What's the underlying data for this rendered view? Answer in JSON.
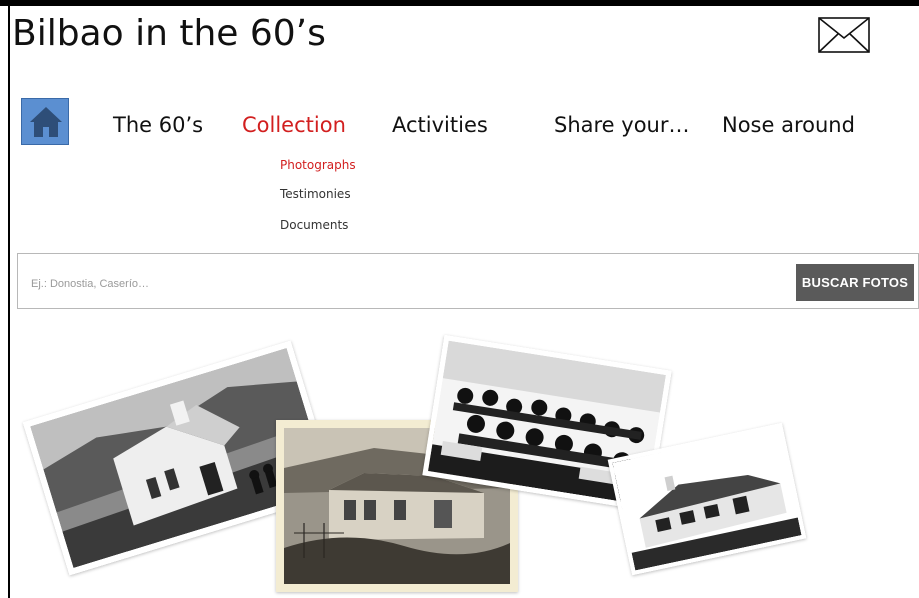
{
  "site": {
    "title": "Bilbao in the 60’s"
  },
  "header_icons": {
    "mail": "mail-envelope-icon",
    "home": "home-icon"
  },
  "nav": {
    "items": [
      {
        "label": "The 60’s",
        "active": false
      },
      {
        "label": "Collection",
        "active": true
      },
      {
        "label": "Activities",
        "active": false
      },
      {
        "label": "Share your…",
        "active": false
      },
      {
        "label": "Nose around",
        "active": false
      }
    ],
    "submenu": [
      {
        "label": "Photographs",
        "active": true
      },
      {
        "label": "Testimonies",
        "active": false
      },
      {
        "label": "Documents",
        "active": false
      }
    ]
  },
  "search": {
    "placeholder": "Ej.: Donostia, Caserío…",
    "button": "BUSCAR FOTOS"
  },
  "colors": {
    "accent": "#d21f1f",
    "home_button": "#5b8fd1",
    "search_button": "#5a5a5a"
  }
}
